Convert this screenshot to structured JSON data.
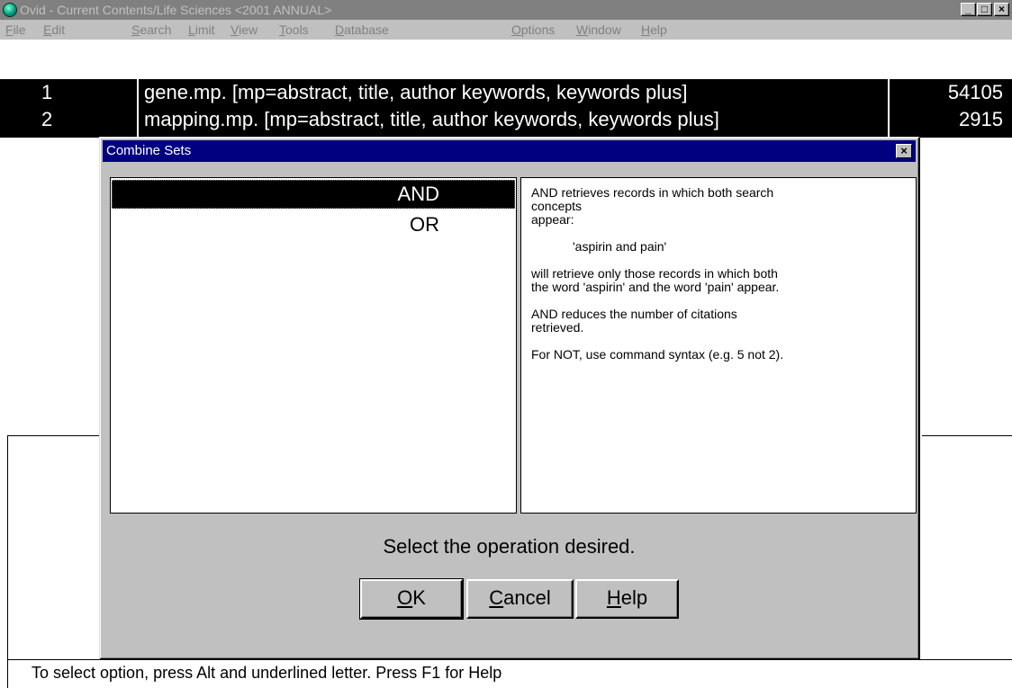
{
  "window": {
    "title": "Ovid - Current Contents/Life Sciences <2001 ANNUAL>",
    "min_label": "_",
    "max_label": "□",
    "close_label": "×"
  },
  "menu": {
    "items": [
      {
        "pre": "",
        "accel": "F",
        "post": "ile"
      },
      {
        "pre": "",
        "accel": "E",
        "post": "dit"
      },
      {
        "pre": "",
        "accel": "S",
        "post": "earch"
      },
      {
        "pre": "",
        "accel": "L",
        "post": "imit"
      },
      {
        "pre": "",
        "accel": "V",
        "post": "iew"
      },
      {
        "pre": "",
        "accel": "T",
        "post": "ools"
      },
      {
        "pre": "",
        "accel": "D",
        "post": "atabase"
      },
      {
        "pre": "",
        "accel": "O",
        "post": "ptions"
      },
      {
        "pre": "",
        "accel": "W",
        "post": "indow"
      },
      {
        "pre": "",
        "accel": "H",
        "post": "elp"
      }
    ]
  },
  "history": [
    {
      "num": "1",
      "query": "gene.mp. [mp=abstract, title, author keywords, keywords plus]",
      "count": "54105"
    },
    {
      "num": "2",
      "query": "mapping.mp. [mp=abstract, title, author keywords, keywords plus]",
      "count": "2915"
    }
  ],
  "dialog": {
    "title": "Combine Sets",
    "close_label": "×",
    "operations": [
      {
        "label": "AND",
        "selected": true
      },
      {
        "label": "OR",
        "selected": false
      }
    ],
    "help_lines": [
      "AND retrieves records in which both search concepts",
      "appear:",
      "'aspirin and pain'",
      "will retrieve only those records in which both the word 'aspirin' and the word 'pain' appear.",
      "AND reduces the number of citations retrieved.",
      "For NOT, use command syntax (e.g. 5 not 2)."
    ],
    "hint": "Select the operation desired.",
    "buttons": {
      "ok": {
        "accel": "O",
        "rest": "K"
      },
      "cancel": {
        "accel": "C",
        "rest": "ancel"
      },
      "help": {
        "accel": "H",
        "rest": "elp"
      }
    }
  },
  "status": {
    "text": "To select option, press Alt and underlined letter.  Press F1 for Help"
  },
  "colors": {
    "title_inactive": "#808080",
    "dialog_title": "#000080",
    "face": "#c0c0c0",
    "selection": "#000000"
  }
}
